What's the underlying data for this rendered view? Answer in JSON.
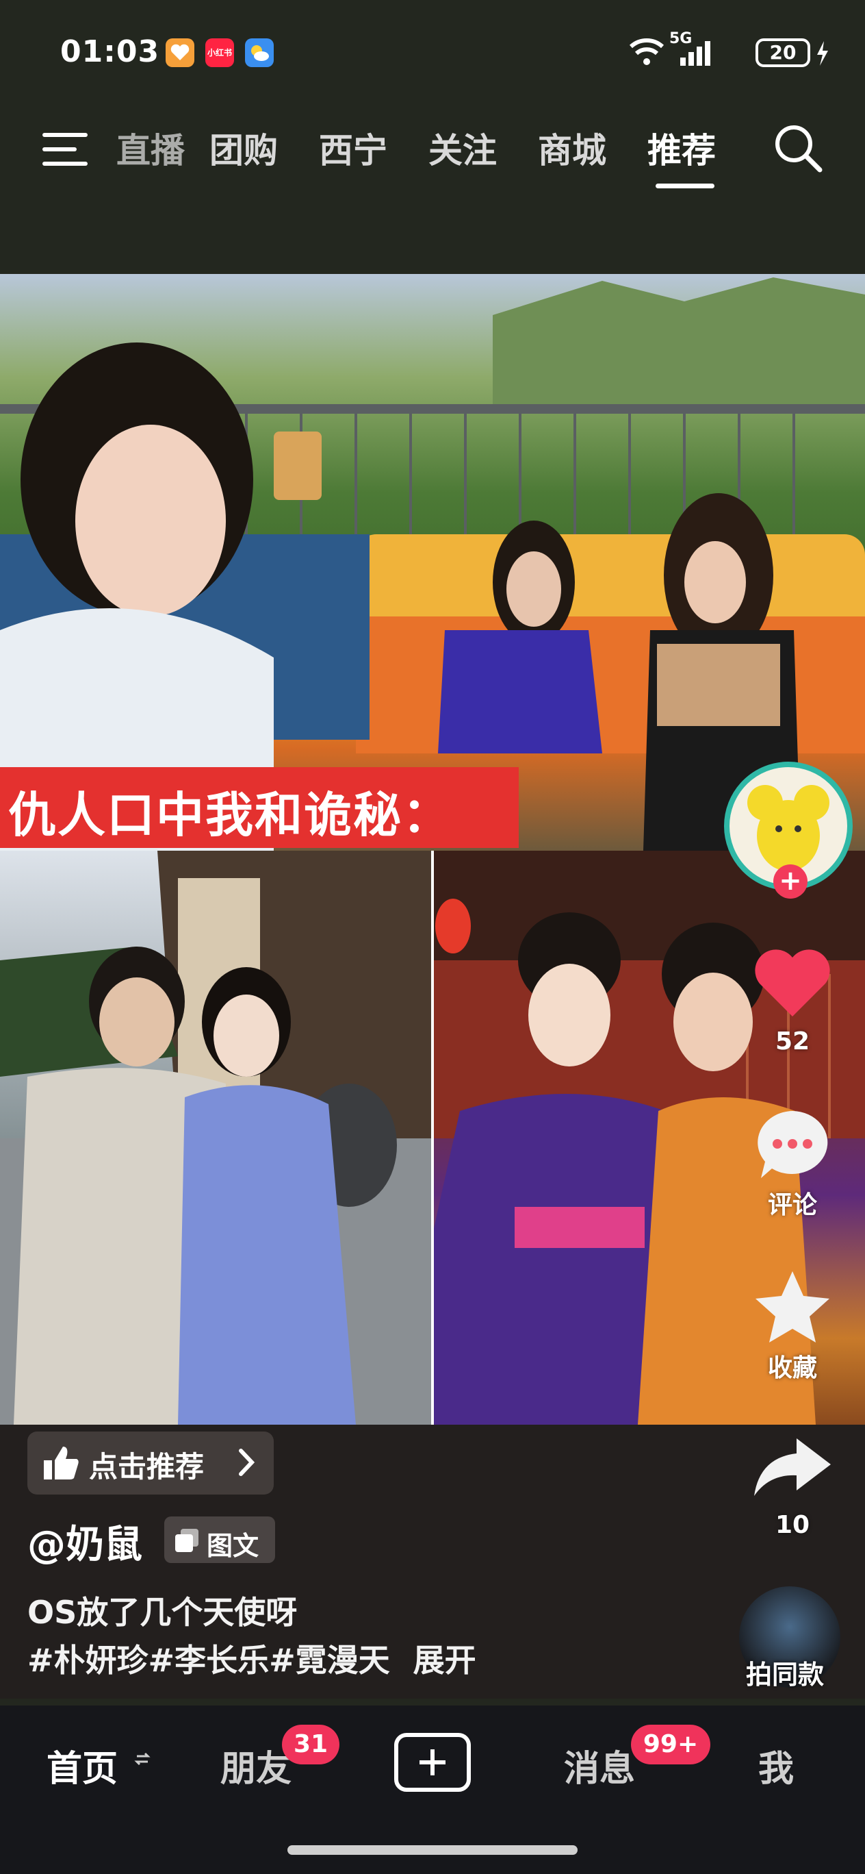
{
  "status_bar": {
    "time": "01:03",
    "network": "5G",
    "battery": "20",
    "apps": [
      {
        "name": "taobao-heart-icon",
        "color": "#f6a03a"
      },
      {
        "name": "xiaohongshu-icon",
        "label": "小红书",
        "color": "#ff2442"
      },
      {
        "name": "weather-icon",
        "color": "#3a8ff0"
      }
    ]
  },
  "top_nav": {
    "tabs": [
      {
        "label": "直播",
        "active": false
      },
      {
        "label": "团购",
        "active": false
      },
      {
        "label": "西宁",
        "active": false
      },
      {
        "label": "关注",
        "active": false
      },
      {
        "label": "商城",
        "active": false
      },
      {
        "label": "推荐",
        "active": true
      }
    ]
  },
  "post": {
    "overlay_caption": "仇人口中我和诡秘：",
    "like_count": "52",
    "comment_label": "评论",
    "collect_label": "收藏",
    "share_count": "10",
    "recommend_chip": "点击推荐",
    "author": "@奶鼠",
    "type_badge": "图文",
    "caption_line1": "OS放了几个天使呀",
    "caption_line2": "#朴妍珍#李长乐#霓漫天",
    "expand_label": "展开",
    "same_style_label": "拍同款",
    "accent_color": "#f23a5a"
  },
  "bottom_nav": {
    "items": [
      {
        "label": "首页",
        "active": true
      },
      {
        "label": "朋友",
        "badge": "31"
      },
      {
        "label": "消息",
        "badge": "99+"
      },
      {
        "label": "我"
      }
    ]
  }
}
